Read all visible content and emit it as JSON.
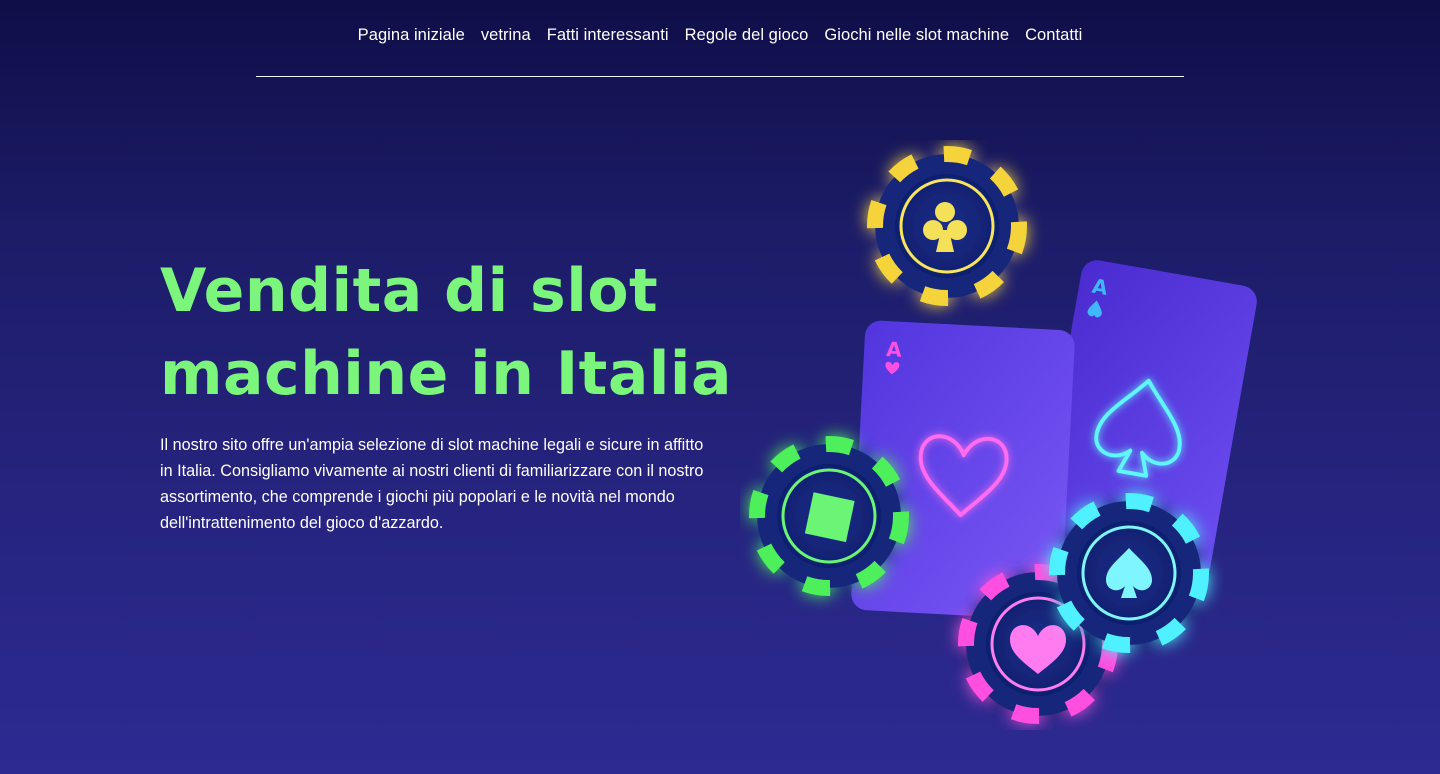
{
  "nav": {
    "items": [
      {
        "label": "Pagina iniziale"
      },
      {
        "label": "vetrina"
      },
      {
        "label": "Fatti interessanti"
      },
      {
        "label": "Regole del gioco"
      },
      {
        "label": "Giochi nelle slot machine"
      },
      {
        "label": "Contatti"
      }
    ]
  },
  "hero": {
    "title": "Vendita di slot machine in Italia",
    "description": "Il nostro sito offre un'ampia selezione di slot machine legali e sicure in affitto in Italia. Consigliamo vivamente ai nostri clienti di familiarizzare con il nostro assortimento, che comprende i giochi più popolari e le novità nel mondo dell'intrattenimento del gioco d'azzardo."
  },
  "illustration": {
    "card_back_rank": "A",
    "card_front_rank": "A",
    "colors": {
      "title": "#7cf57c",
      "chip_yellow": "#f5d43a",
      "chip_green": "#4df05a",
      "chip_pink": "#ff4fe0",
      "chip_cyan": "#4ff0ff",
      "card": "#5a3ee0"
    },
    "icons": [
      "club-icon",
      "diamond-icon",
      "heart-icon",
      "spade-icon"
    ]
  }
}
